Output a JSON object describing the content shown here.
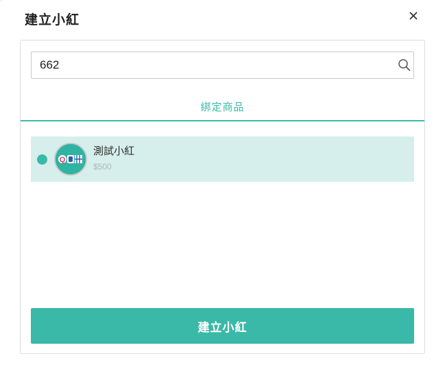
{
  "modal": {
    "title": "建立小紅",
    "close_icon": "close-icon"
  },
  "search": {
    "value": "662",
    "icon": "search-icon"
  },
  "tabs": [
    {
      "label": "綁定商品",
      "active": true
    }
  ],
  "products": [
    {
      "name": "測試小紅",
      "price": "$500",
      "selected": true,
      "avatar_icon": "product-logo-icon"
    }
  ],
  "submit_button": {
    "label": "建立小紅"
  },
  "colors": {
    "accent": "#3bb9a8",
    "selected_row": "#d6efec",
    "price_text": "#a9b9b6"
  }
}
